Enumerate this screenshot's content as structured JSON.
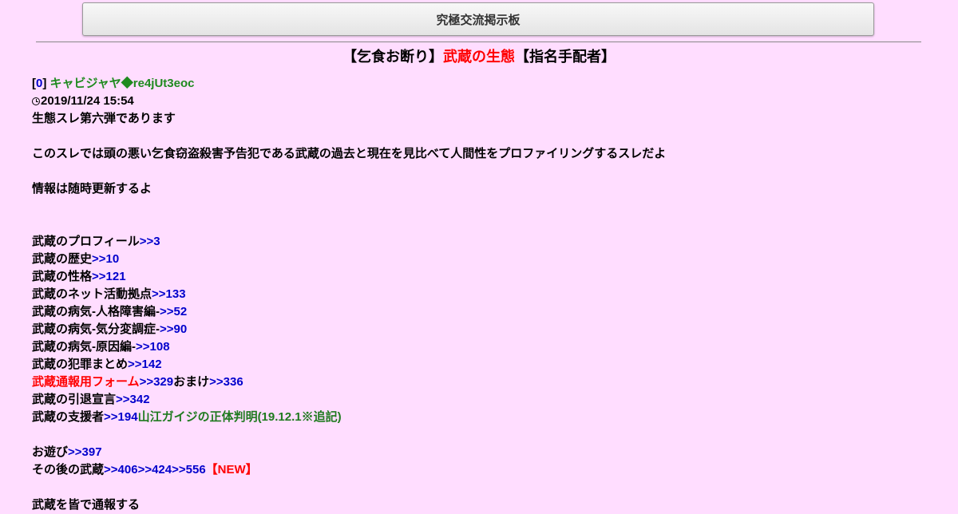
{
  "site": {
    "title": "究極交流掲示板"
  },
  "thread": {
    "title_prefix": "【乞食お断り】",
    "title_highlight": "武蔵の生態",
    "title_suffix": "【指名手配者】"
  },
  "post": {
    "number": "0",
    "author": "キャビジャヤ◆re4jUt3eoc",
    "datetime": "2019/11/24 15:54",
    "intro_line1": "生態スレ第六弾であります",
    "intro_line2": "このスレでは頭の悪い乞食窃盗殺害予告犯である武蔵の過去と現在を見比べて人間性をプロファイリングするスレだよ",
    "intro_line3": "情報は随時更新するよ",
    "links": [
      {
        "label": "武蔵のプロフィール",
        "anchor": ">>3"
      },
      {
        "label": "武蔵の歴史",
        "anchor": ">>10"
      },
      {
        "label": "武蔵の性格",
        "anchor": ">>121"
      },
      {
        "label": "武蔵のネット活動拠点",
        "anchor": ">>133"
      },
      {
        "label": "武蔵の病気-人格障害編-",
        "anchor": ">>52"
      },
      {
        "label": "武蔵の病気-気分変調症-",
        "anchor": ">>90"
      },
      {
        "label": "武蔵の病気-原因編-",
        "anchor": ">>108"
      },
      {
        "label": "武蔵の犯罪まとめ",
        "anchor": ">>142"
      }
    ],
    "report_line": {
      "label": "武蔵通報用フォーム",
      "anchor1": ">>329",
      "middle": "おまけ",
      "anchor2": ">>336"
    },
    "retire_line": {
      "label": "武蔵の引退宣言",
      "anchor": ">>342"
    },
    "supporter_line": {
      "label": "武蔵の支援者",
      "anchor": ">>194",
      "note": "山江ガイジの正体判明(19.12.1※追記)"
    },
    "play_line": {
      "label": "お遊び",
      "anchor": ">>397"
    },
    "after_line": {
      "label": "その後の武蔵",
      "anchor1": ">>406",
      "anchor2": ">>424",
      "anchor3": ">>556",
      "badge": "【NEW】"
    },
    "cutoff_line": "武蔵を皆で通報する"
  },
  "colors": {
    "background": "#ffddff",
    "accent_red": "#ff0000",
    "link_blue": "#0000cc",
    "name_green": "#1f8a1f"
  }
}
